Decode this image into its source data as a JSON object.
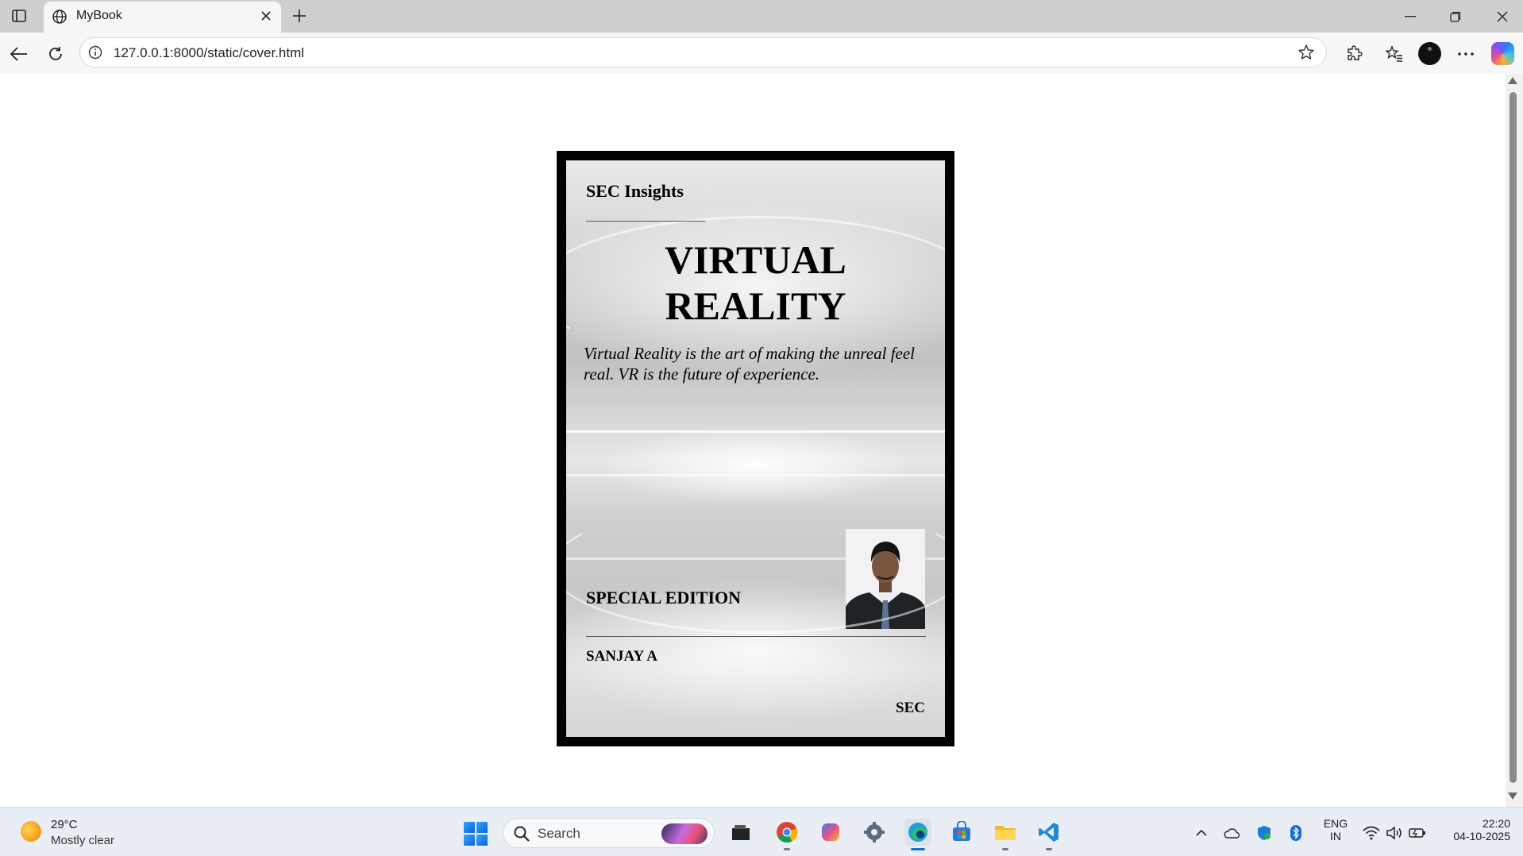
{
  "browser": {
    "tab": {
      "title": "MyBook"
    },
    "address": {
      "url": "127.0.0.1:8000/static/cover.html"
    }
  },
  "cover": {
    "brand": "SEC Insights",
    "title_line1": "VIRTUAL",
    "title_line2": "REALITY",
    "tagline": "Virtual Reality is the art of making the unreal feel real. VR is the future of experience.",
    "edition": "SPECIAL EDITION",
    "author": "SANJAY A",
    "publisher": "SEC"
  },
  "taskbar": {
    "weather": {
      "temp": "29°C",
      "desc": "Mostly clear"
    },
    "search_label": "Search",
    "tray": {
      "lang_line1": "ENG",
      "lang_line2": "IN",
      "time": "22:20",
      "date": "04-10-2025"
    },
    "apps": [
      "file-explorer-icon",
      "chrome-icon",
      "copilot-app-icon",
      "settings-icon",
      "edge-icon",
      "store-icon",
      "folder-icon",
      "vscode-icon"
    ]
  }
}
